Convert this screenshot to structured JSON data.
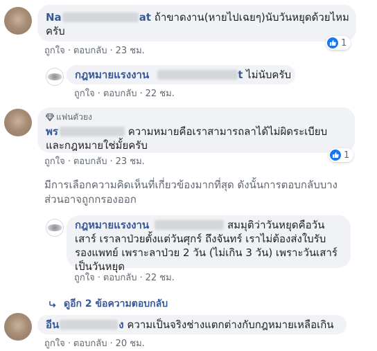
{
  "comments": [
    {
      "author_visible": "Na",
      "author_tail": "at",
      "text": "ถ้าขาดงาน(หายไปเฉยๆ)นับวันหยุดด้วยไหมครับ",
      "text_line1": "ถ้าขาดงาน(หายไปเฉยๆ)นับวันหยุดด้วยไหม",
      "text_line2": "ครับ",
      "like": "ถูกใจ",
      "reply": "ตอบกลับ",
      "time": "23 ชม.",
      "reactions": "1"
    },
    {
      "author_visible": "กฎหมายแรงงาน",
      "author_tail": "t",
      "text": "ไม่นับครับ",
      "like": "ถูกใจ",
      "reply": "ตอบกลับ",
      "time": "22 ชม."
    },
    {
      "badge": "แฟนตัวยง",
      "author_visible": "พร",
      "text_line1": "ความหมายคือเราสามารถลาได้ไม่ผิดระเบียบ",
      "text_line2": "และกฎหมายใช่มั้ยครับ",
      "like": "ถูกใจ",
      "reply": "ตอบกลับ",
      "time": "23 ชม.",
      "reactions": "1"
    },
    {
      "author_visible": "กฎหมายแรงงาน",
      "text_line1": "สมมุติว่าวันหยุดคือวัน",
      "text_line2": "เสาร์ เราลาป่วยตั้งแต่วันศุกร์ ถึงจันทร์ เราไม่ต้องส่งใบรับ",
      "text_line3": "รองแพทย์ เพราะลาป่วย 2 วัน (ไม่เกิน 3 วัน) เพราะวันเสาร์",
      "text_line4": "เป็นวันหยุด",
      "like": "ถูกใจ",
      "reply": "ตอบกลับ",
      "time": "22 ชม."
    },
    {
      "author_visible": "อีน",
      "author_tail": "ง",
      "text": "ความเป็นจริงช่างแตกต่างกับกฎหมายเหลือเกิน",
      "like": "ถูกใจ",
      "reply": "ตอบกลับ",
      "time": "20 ชม."
    }
  ],
  "filter_note_line1": "มีการเลือกความคิดเห็นที่เกี่ยวข้องมากที่สุด ดังนั้นการตอบกลับบาง",
  "filter_note_line2": "ส่วนอาจถูกกรองออก",
  "view_more_replies": "ดูอีก 2 ข้อความตอบกลับ",
  "separator": "·",
  "colors": {
    "link": "#385898",
    "bubble": "#f0f2f5",
    "muted": "#606770",
    "like_blue": "#1877f2"
  },
  "icons": {
    "like": "thumbs-up-icon",
    "badge": "diamond-icon",
    "reply_arrow": "reply-arrow-icon"
  }
}
